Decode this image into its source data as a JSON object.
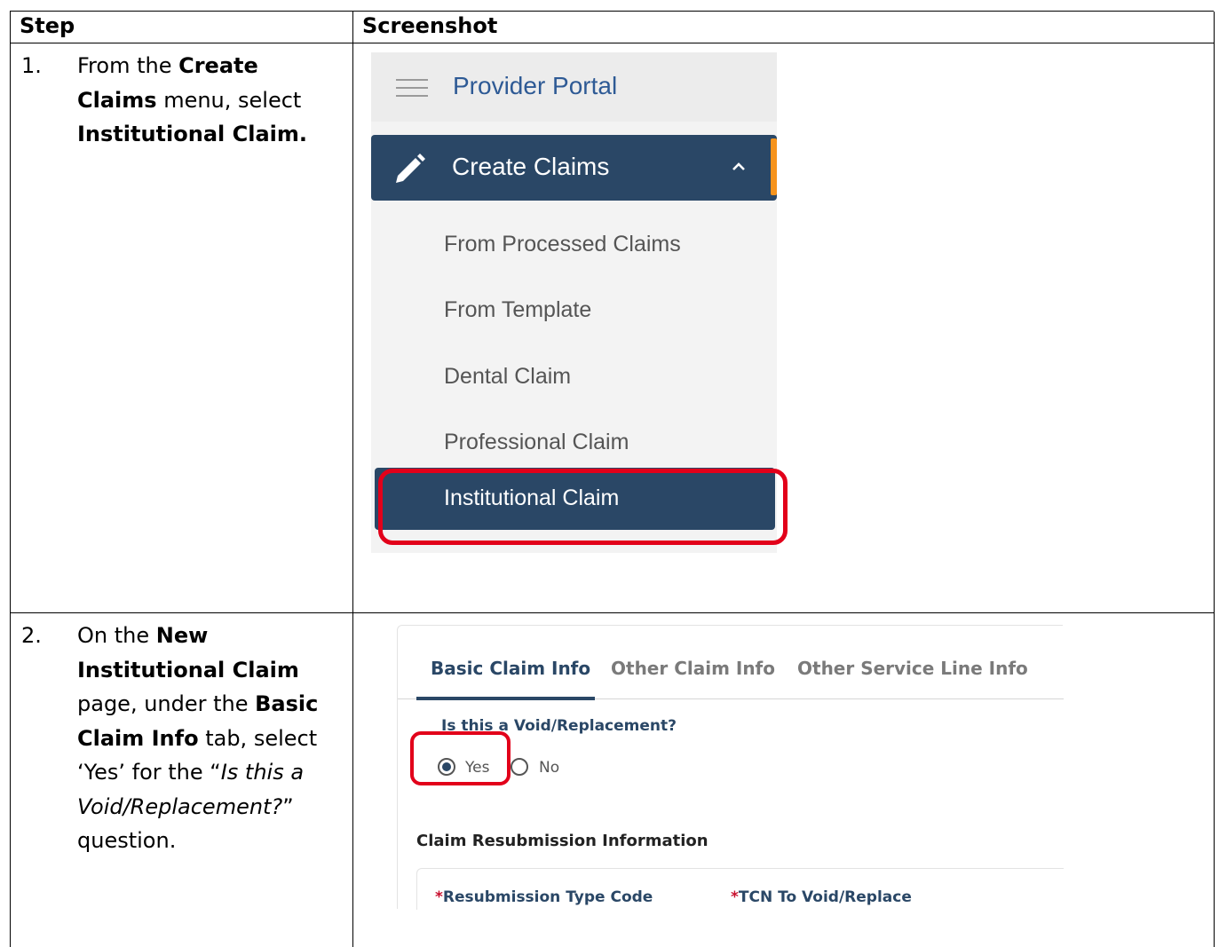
{
  "table": {
    "header_step": "Step",
    "header_screenshot": "Screenshot"
  },
  "step1": {
    "number": "1.",
    "text_parts": [
      "From the ",
      "Create Claims",
      " menu, select ",
      "Institutional Claim."
    ]
  },
  "step2": {
    "number": "2.",
    "text_parts": [
      "On the ",
      "New Institutional Claim",
      " page, under the ",
      "Basic Claim Info",
      " tab, select ‘Yes’ for the “",
      "Is this a Void/Replacement?",
      "” question."
    ]
  },
  "nav": {
    "portal_title": "Provider Portal",
    "create_claims_label": "Create Claims",
    "items": [
      "From Processed Claims",
      "From Template",
      "Dental Claim",
      "Professional Claim"
    ],
    "selected_item": "Institutional Claim",
    "colors": {
      "nav_bg": "#2a4766",
      "accent": "#f7941d",
      "highlight": "#e2001a"
    }
  },
  "claim_form": {
    "tabs": [
      "Basic Claim Info",
      "Other Claim Info",
      "Other Service Line Info"
    ],
    "active_tab": "Basic Claim Info",
    "question": "Is this a Void/Replacement?",
    "options": [
      "Yes",
      "No"
    ],
    "selected_option": "Yes",
    "section_title": "Claim Resubmission Information",
    "fields": [
      {
        "required_mark": "*",
        "label": "Resubmission Type Code"
      },
      {
        "required_mark": "*",
        "label": "TCN To Void/Replace"
      }
    ]
  }
}
